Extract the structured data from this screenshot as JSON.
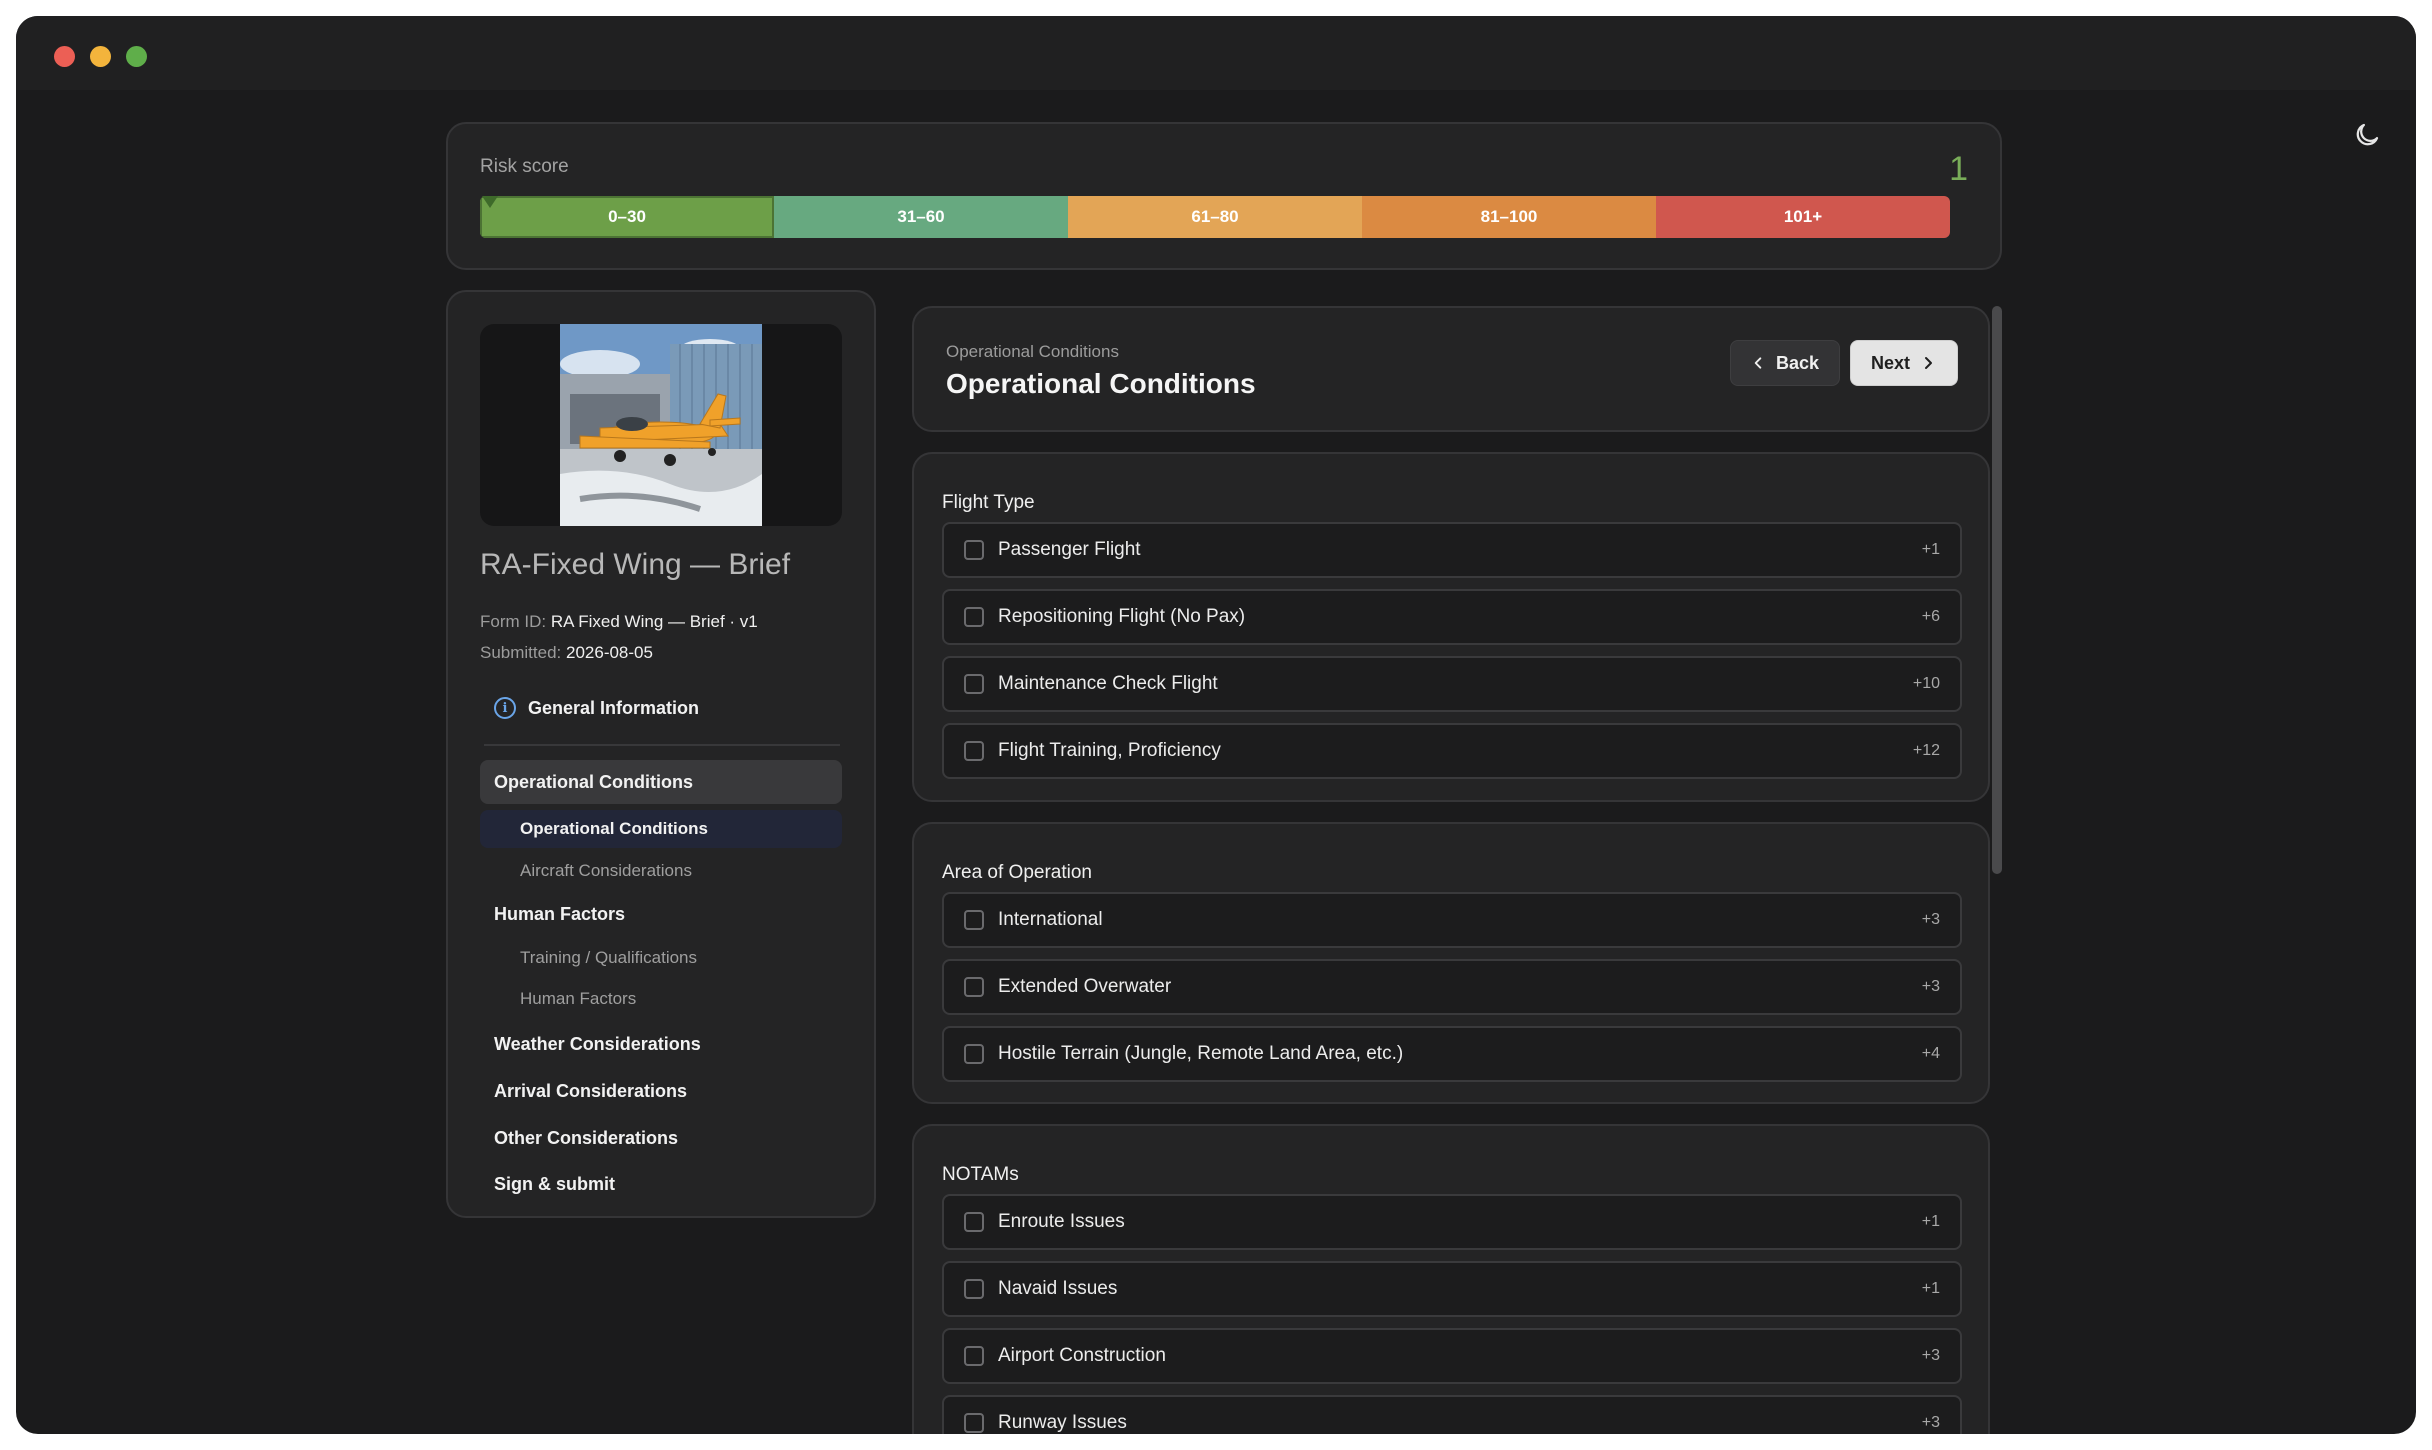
{
  "risk": {
    "label": "Risk score",
    "value": "1",
    "segments": [
      "0–30",
      "31–60",
      "61–80",
      "81–100",
      "101+"
    ],
    "colors": [
      "#6d9f48",
      "#67a980",
      "#e3a556",
      "#db8a42",
      "#d0574e"
    ]
  },
  "form": {
    "title": "RA-Fixed Wing — Brief",
    "form_id_label": "Form ID:",
    "form_id_value": "RA Fixed Wing — Brief · v1",
    "submitted_label": "Submitted:",
    "submitted_value": "2026-08-05"
  },
  "nav": {
    "general": "General Information",
    "groups": [
      {
        "label": "Operational Conditions",
        "subs": [
          "Operational Conditions",
          "Aircraft Considerations"
        ]
      },
      {
        "label": "Human Factors",
        "subs": [
          "Training / Qualifications",
          "Human Factors"
        ]
      },
      {
        "label": "Weather Considerations"
      },
      {
        "label": "Arrival Considerations"
      },
      {
        "label": "Other Considerations"
      },
      {
        "label": "Sign & submit"
      }
    ]
  },
  "header": {
    "breadcrumb": "Operational Conditions",
    "title": "Operational Conditions",
    "back_label": "Back",
    "next_label": "Next"
  },
  "sections": [
    {
      "title": "Flight Type",
      "options": [
        {
          "label": "Passenger Flight",
          "points": "+1"
        },
        {
          "label": "Repositioning Flight (No Pax)",
          "points": "+6"
        },
        {
          "label": "Maintenance Check Flight",
          "points": "+10"
        },
        {
          "label": "Flight Training, Proficiency",
          "points": "+12"
        }
      ]
    },
    {
      "title": "Area of Operation",
      "options": [
        {
          "label": "International",
          "points": "+3"
        },
        {
          "label": "Extended Overwater",
          "points": "+3"
        },
        {
          "label": "Hostile Terrain (Jungle, Remote Land Area, etc.)",
          "points": "+4"
        }
      ]
    },
    {
      "title": "NOTAMs",
      "options": [
        {
          "label": "Enroute Issues",
          "points": "+1"
        },
        {
          "label": "Navaid Issues",
          "points": "+1"
        },
        {
          "label": "Airport Construction",
          "points": "+3"
        },
        {
          "label": "Runway Issues",
          "points": "+3"
        }
      ]
    }
  ]
}
